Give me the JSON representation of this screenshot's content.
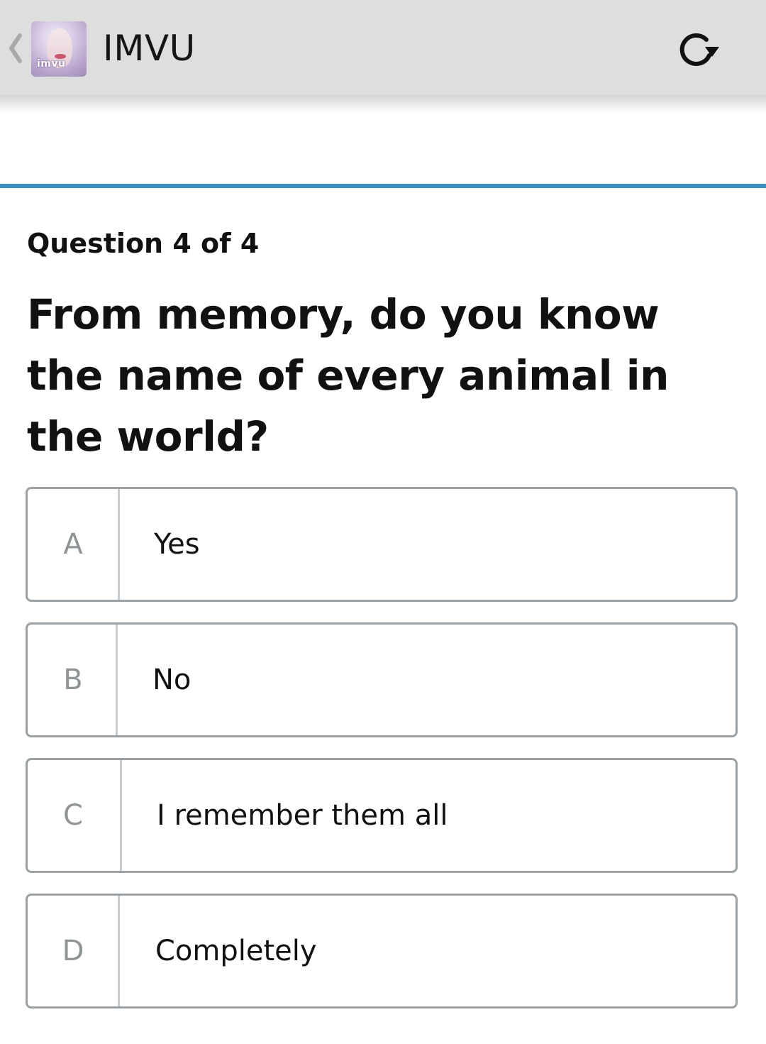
{
  "app_bar": {
    "title": "IMVU",
    "icon_badge_text": "imvu",
    "back_icon": "chevron-left-icon",
    "refresh_icon": "refresh-icon"
  },
  "progress": {
    "fraction_complete": 1.0,
    "color": "#3a8fc1"
  },
  "question": {
    "counter": "Question 4 of 4",
    "text": "From memory, do you know the name of every animal in the world?"
  },
  "options": [
    {
      "letter": "A",
      "label": "Yes"
    },
    {
      "letter": "B",
      "label": "No"
    },
    {
      "letter": "C",
      "label": "I remember them all"
    },
    {
      "letter": "D",
      "label": "Completely"
    }
  ]
}
